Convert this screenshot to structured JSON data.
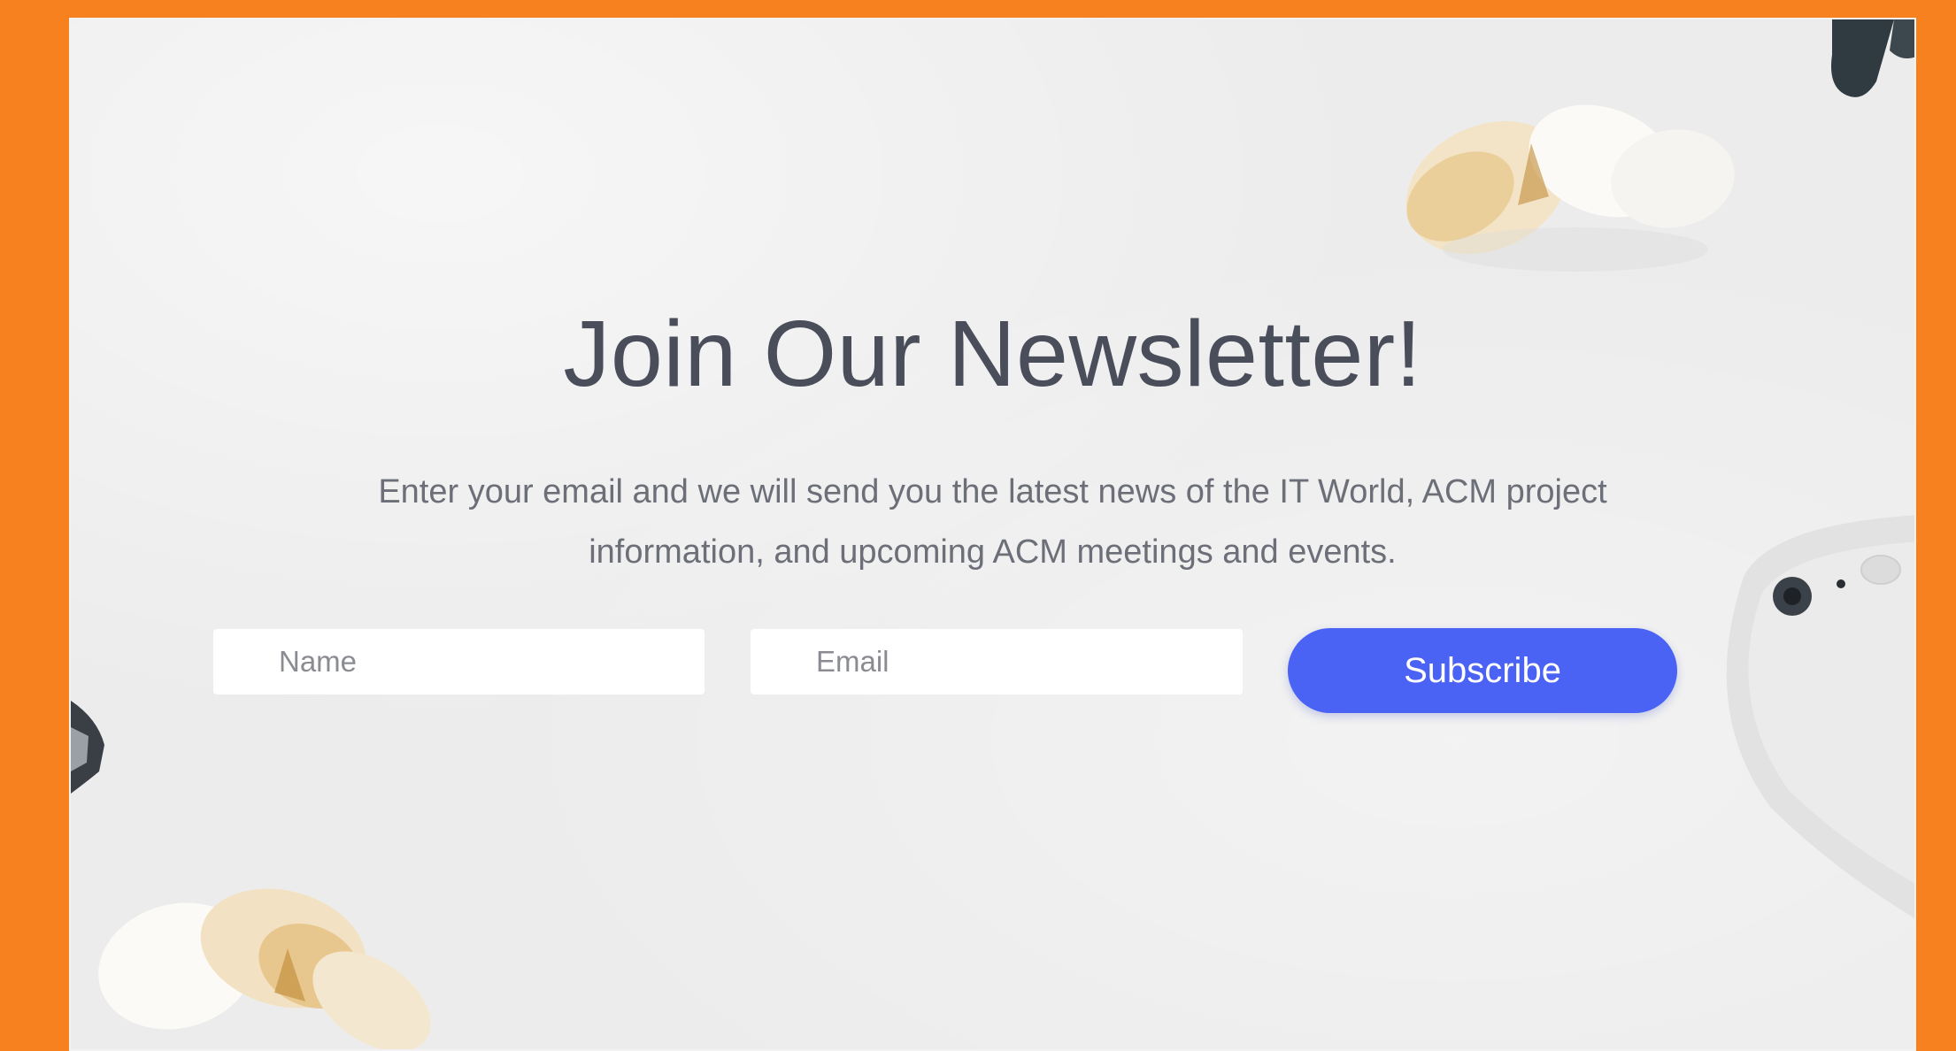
{
  "newsletter": {
    "title": "Join Our Newsletter!",
    "description": "Enter your email and we will send you the latest news of the IT World, ACM project information, and upcoming ACM meetings and events.",
    "name_placeholder": "Name",
    "email_placeholder": "Email",
    "subscribe_label": "Subscribe"
  },
  "colors": {
    "page_background": "#f7811f",
    "panel_background": "#ececec",
    "title_text": "#4a4d5a",
    "body_text": "#6c6f78",
    "subscribe_button": "#4a63f4"
  },
  "decorations": [
    "dried-flower-top-right",
    "dried-flower-bottom-left",
    "smartphone-right",
    "dark-object-top-right",
    "dark-object-left"
  ]
}
